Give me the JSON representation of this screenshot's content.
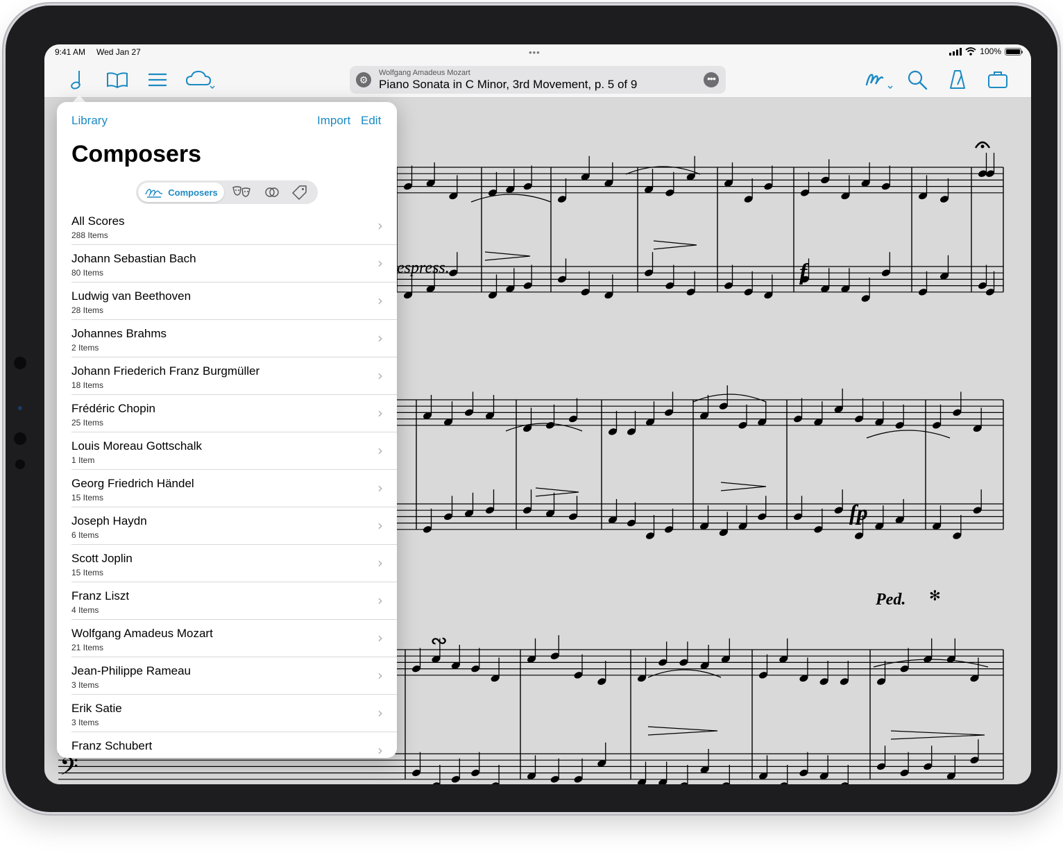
{
  "status_bar": {
    "time": "9:41 AM",
    "date": "Wed Jan 27",
    "battery": "100%"
  },
  "toolbar": {
    "left_icons": [
      "note-icon",
      "book-icon",
      "list-icon",
      "cloud-icon"
    ],
    "right_icons": [
      "annotate-icon",
      "search-icon",
      "metronome-icon",
      "setlist-icon"
    ],
    "title_pill": {
      "composer": "Wolfgang Amadeus Mozart",
      "title": "Piano Sonata in C Minor, 3rd Movement, p. 5 of 9"
    }
  },
  "popover": {
    "back_label": "Library",
    "import_label": "Import",
    "edit_label": "Edit",
    "heading": "Composers",
    "segments": {
      "active_label": "Composers",
      "icons": [
        "composers-icon",
        "genres-icon",
        "collections-icon",
        "tags-icon"
      ]
    },
    "items": [
      {
        "name": "All Scores",
        "count": "288 Items"
      },
      {
        "name": "Johann Sebastian Bach",
        "count": "80 Items"
      },
      {
        "name": "Ludwig van Beethoven",
        "count": "28 Items"
      },
      {
        "name": "Johannes Brahms",
        "count": "2 Items"
      },
      {
        "name": "Johann Friederich Franz Burgmüller",
        "count": "18 Items"
      },
      {
        "name": "Frédéric Chopin",
        "count": "25 Items"
      },
      {
        "name": "Louis Moreau Gottschalk",
        "count": "1 Item"
      },
      {
        "name": "Georg Friedrich Händel",
        "count": "15 Items"
      },
      {
        "name": "Joseph Haydn",
        "count": "6 Items"
      },
      {
        "name": "Scott Joplin",
        "count": "15 Items"
      },
      {
        "name": "Franz Liszt",
        "count": "4 Items"
      },
      {
        "name": "Wolfgang Amadeus Mozart",
        "count": "21 Items"
      },
      {
        "name": "Jean-Philippe Rameau",
        "count": "3 Items"
      },
      {
        "name": "Erik Satie",
        "count": "3 Items"
      },
      {
        "name": "Franz Schubert",
        "count": ""
      }
    ]
  },
  "score": {
    "markings": {
      "espressivo": "espress.",
      "forte": "f",
      "forte_piano": "fp",
      "pedal": "Ped."
    }
  },
  "colors": {
    "accent": "#1b8ac3",
    "screen_bg": "#d9d9d9",
    "popover_bg": "#ffffff"
  }
}
